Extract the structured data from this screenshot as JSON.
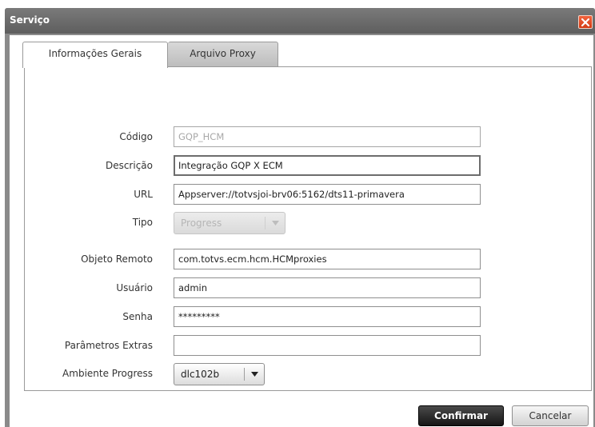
{
  "dialog": {
    "title": "Serviço",
    "close_icon": "close-icon"
  },
  "tabs": [
    {
      "label": "Informações Gerais",
      "active": true
    },
    {
      "label": "Arquivo Proxy",
      "active": false
    }
  ],
  "form": {
    "codigo": {
      "label": "Código",
      "value": "GQP_HCM",
      "disabled": true
    },
    "descricao": {
      "label": "Descrição",
      "value": "Integração GQP X ECM"
    },
    "url": {
      "label": "URL",
      "value": "Appserver://totvsjoi-brv06:5162/dts11-primavera"
    },
    "tipo": {
      "label": "Tipo",
      "value": "Progress",
      "disabled": true
    },
    "objeto_remoto": {
      "label": "Objeto Remoto",
      "value": "com.totvs.ecm.hcm.HCMproxies"
    },
    "usuario": {
      "label": "Usuário",
      "value": "admin"
    },
    "senha": {
      "label": "Senha",
      "value": "*********"
    },
    "parametros_extras": {
      "label": "Parâmetros Extras",
      "value": ""
    },
    "ambiente_progress": {
      "label": "Ambiente Progress",
      "value": "dlc102b"
    }
  },
  "buttons": {
    "confirm": "Confirmar",
    "cancel": "Cancelar"
  },
  "colors": {
    "titlebar": "#6b6b6b",
    "close": "#e0502a",
    "confirm_bg": "#1e1e1e"
  }
}
